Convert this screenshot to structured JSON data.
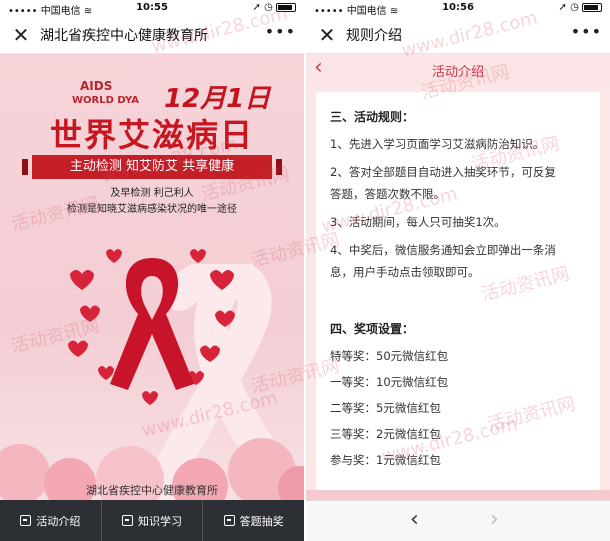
{
  "left": {
    "status": {
      "carrier": "中国电信",
      "time": "10:55"
    },
    "nav_title": "湖北省疾控中心健康教育所",
    "poster": {
      "aids": "AIDS",
      "world_day": "WORLD DYA",
      "date": "12月1日",
      "title": "世界艾滋病日",
      "banner": "主动检测 知艾防艾 共享健康",
      "sub1": "及早检测  利己利人",
      "sub2": "检测是知晓艾滋病感染状况的唯一途径",
      "org": "湖北省疾控中心健康教育所"
    },
    "tabs": [
      {
        "label": "活动介绍"
      },
      {
        "label": "知识学习"
      },
      {
        "label": "答题抽奖"
      }
    ]
  },
  "right": {
    "status": {
      "carrier": "中国电信",
      "time": "10:56"
    },
    "nav_title": "规则介绍",
    "subhead": "活动介绍",
    "content": [
      "三、活动规则：",
      "1、先进入学习页面学习艾滋病防治知识。",
      "2、答对全部题目自动进入抽奖环节，可反复",
      "答题，答题次数不限。",
      "3、活动期间，每人只可抽奖1次。",
      "4、中奖后，微信服务通知会立即弹出一条消",
      "息，用户手动点击领取即可。",
      "四、奖项设置：",
      "特等奖：50元微信红包",
      "一等奖：10元微信红包",
      "二等奖：5元微信红包",
      "三等奖：2元微信红包",
      "参与奖：1元微信红包"
    ]
  },
  "watermarks": [
    "活动资讯网",
    "www.dir28.com"
  ],
  "colors": {
    "accent": "#c81620",
    "tabbar": "#2c3035"
  }
}
